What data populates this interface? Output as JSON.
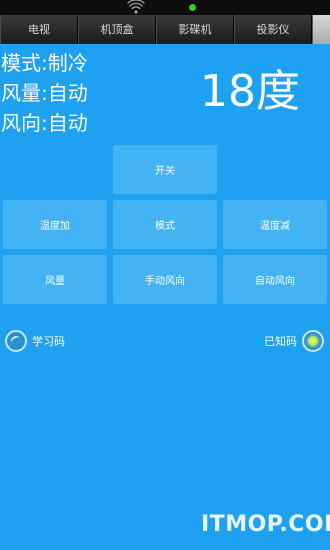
{
  "tabs": [
    "电视",
    "机顶盒",
    "影碟机",
    "投影仪"
  ],
  "status": {
    "mode": "模式:制冷",
    "fan_speed": "风量:自动",
    "fan_direction": "风向:自动"
  },
  "temperature": "18度",
  "buttons": {
    "power": "开关",
    "temp_up": "温度加",
    "mode": "模式",
    "temp_down": "温度减",
    "fan_speed": "风量",
    "manual_direction": "手动风向",
    "auto_direction": "自动风向"
  },
  "options": {
    "learn_code": "学习码",
    "known_code": "已知码"
  },
  "watermark": "ITMOP.COM",
  "colors": {
    "background": "#1ea1f0",
    "button": "#44b3f4",
    "tabbar": "#262626"
  }
}
